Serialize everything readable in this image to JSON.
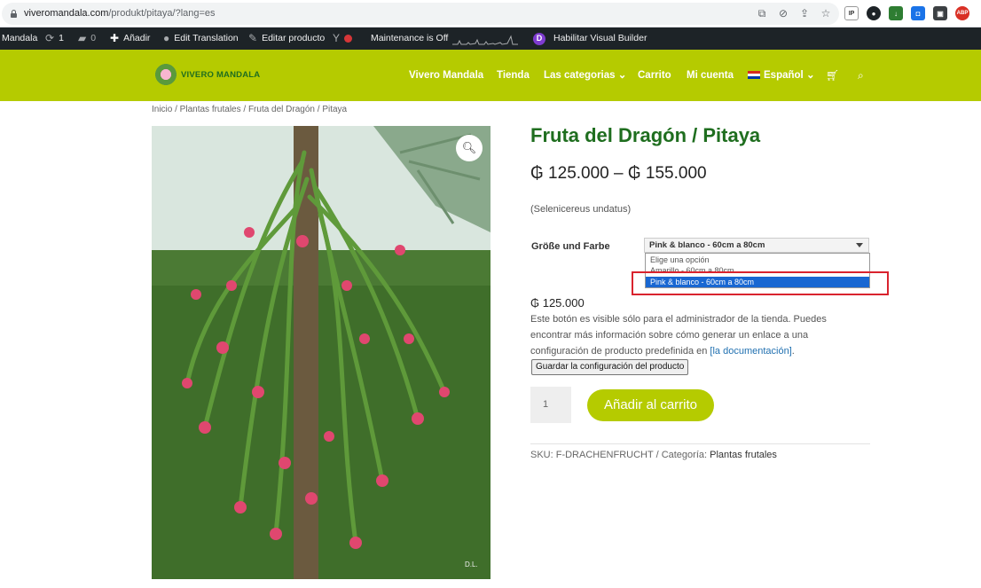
{
  "browser": {
    "url_host": "viveromandala.com",
    "url_path": "/produkt/pitaya/?lang=es",
    "extensions": [
      "IP",
      "ABP"
    ]
  },
  "adminbar": {
    "site": "Mandala",
    "updates": "1",
    "comments": "0",
    "add_new": "Añadir",
    "edit_translation": "Edit Translation",
    "edit_product": "Editar producto",
    "maintenance": "Maintenance is Off",
    "visual_builder": "Habilitar Visual Builder",
    "divi_letter": "D"
  },
  "header": {
    "logo_text": "VIVERO MANDALA",
    "nav": [
      "Vivero Mandala",
      "Tienda",
      "Las categorias",
      "Carrito",
      "Mi cuenta",
      "Español"
    ],
    "brand_color": "#b5cb00"
  },
  "breadcrumb": "Inicio / Plantas frutales / Fruta del Dragón / Pitaya",
  "product": {
    "title": "Fruta del Dragón / Pitaya",
    "price_range": "₲ 125.000 – ₲ 155.000",
    "scientific_name": "(Selenicereus undatus)",
    "variation_label": "Größe und Farbe",
    "selected_option": "Pink & blanco - 60cm a 80cm",
    "options": [
      "Elige una opción",
      "Amarillo - 60cm a 80cm",
      "Pink & blanco - 60cm a 80cm"
    ],
    "variation_price": "₲ 125.000",
    "admin_note_before": "Este botón es visible sólo para el administrador de la tienda. Puedes encontrar más información sobre cómo generar un enlace a una configuración de producto predefinida en ",
    "admin_note_link": "[la documentación]",
    "admin_note_after": ".",
    "save_config_label": "Guardar la configuración del producto",
    "quantity": "1",
    "add_to_cart_label": "Añadir al carrito",
    "sku_label": "SKU: F-DRACHENFRUCHT / Categoría: ",
    "category": "Plantas frutales",
    "image_credit": "D.L."
  }
}
